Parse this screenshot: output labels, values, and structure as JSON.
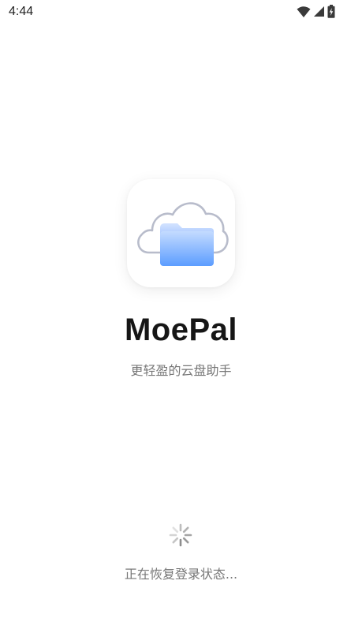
{
  "status_bar": {
    "time": "4:44",
    "icons": [
      "wifi-icon",
      "cellular-signal-icon",
      "battery-charging-icon"
    ]
  },
  "app": {
    "name": "MoePal",
    "tagline": "更轻盈的云盘助手",
    "icon": "cloud-folder-icon"
  },
  "loading": {
    "text": "正在恢复登录状态..."
  },
  "colors": {
    "background": "#ffffff",
    "title": "#161616",
    "muted_text": "#777777",
    "folder_blue_light": "#bcd6ff",
    "folder_blue_dark": "#5c9dff",
    "cloud_outline": "#b8bccb"
  }
}
